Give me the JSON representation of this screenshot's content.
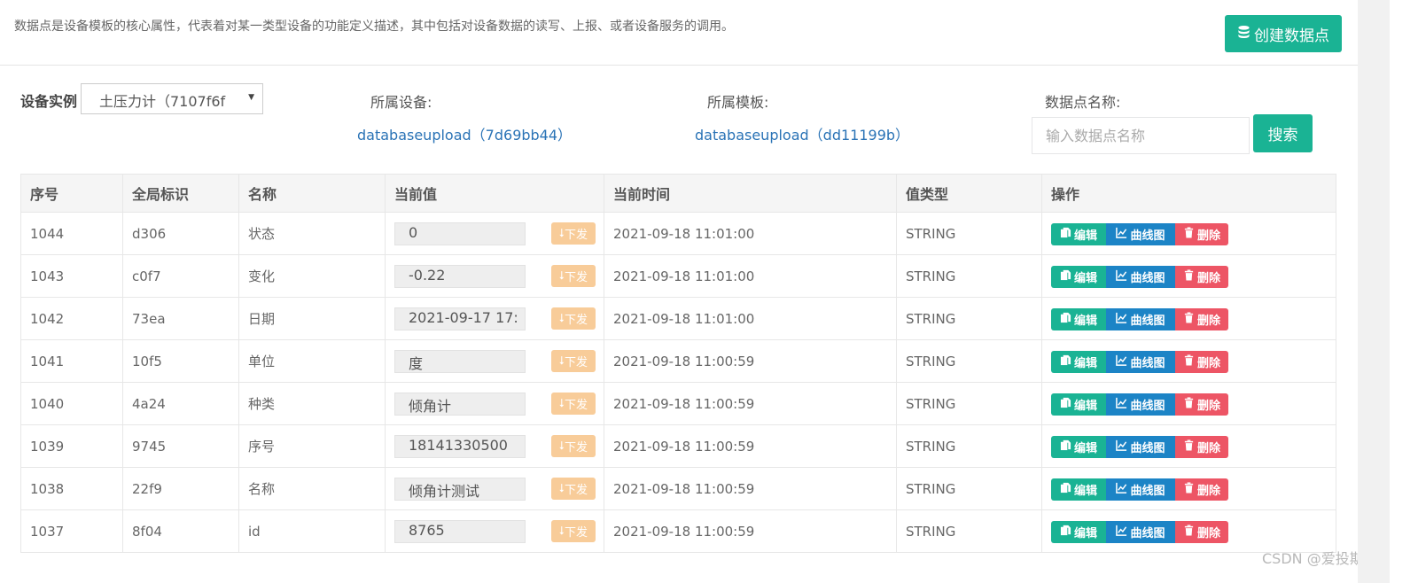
{
  "header": {
    "description": "数据点是设备模板的核心属性，代表着对某一类型设备的功能定义描述，其中包括对设备数据的读写、上报、或者设备服务的调用。",
    "create_button": "创建数据点",
    "create_icon": "database-icon"
  },
  "filters": {
    "instance_label": "设备实例",
    "instance_value": "土压力计（7107f6f",
    "device_label": "所属设备:",
    "device_link": "databaseupload（7d69bb44）",
    "template_label": "所属模板:",
    "template_link": "databaseupload（dd11199b）",
    "datapoint_label": "数据点名称:",
    "datapoint_placeholder": "输入数据点名称",
    "search_button": "搜索"
  },
  "table": {
    "columns": [
      "序号",
      "全局标识",
      "名称",
      "当前值",
      "当前时间",
      "值类型",
      "操作"
    ],
    "send_label": "下发",
    "actions": {
      "edit": "编辑",
      "chart": "曲线图",
      "delete": "删除"
    },
    "rows": [
      {
        "id": "1044",
        "key": "d306",
        "name": "状态",
        "value": "0",
        "time": "2021-09-18 11:01:00",
        "type": "STRING"
      },
      {
        "id": "1043",
        "key": "c0f7",
        "name": "变化",
        "value": "-0.22",
        "time": "2021-09-18 11:01:00",
        "type": "STRING"
      },
      {
        "id": "1042",
        "key": "73ea",
        "name": "日期",
        "value": "2021-09-17 17:",
        "time": "2021-09-18 11:01:00",
        "type": "STRING"
      },
      {
        "id": "1041",
        "key": "10f5",
        "name": "单位",
        "value": "度",
        "time": "2021-09-18 11:00:59",
        "type": "STRING"
      },
      {
        "id": "1040",
        "key": "4a24",
        "name": "种类",
        "value": "倾角计",
        "time": "2021-09-18 11:00:59",
        "type": "STRING"
      },
      {
        "id": "1039",
        "key": "9745",
        "name": "序号",
        "value": "18141330500",
        "time": "2021-09-18 11:00:59",
        "type": "STRING"
      },
      {
        "id": "1038",
        "key": "22f9",
        "name": "名称",
        "value": "倾角计测试",
        "time": "2021-09-18 11:00:59",
        "type": "STRING"
      },
      {
        "id": "1037",
        "key": "8f04",
        "name": "id",
        "value": "8765",
        "time": "2021-09-18 11:00:59",
        "type": "STRING"
      }
    ]
  },
  "watermark": "CSDN @爱投斯",
  "colors": {
    "primary": "#1ab394",
    "info": "#1c84c6",
    "danger": "#ed5565",
    "warning_light": "#f8cc99",
    "link": "#2a73b6"
  }
}
